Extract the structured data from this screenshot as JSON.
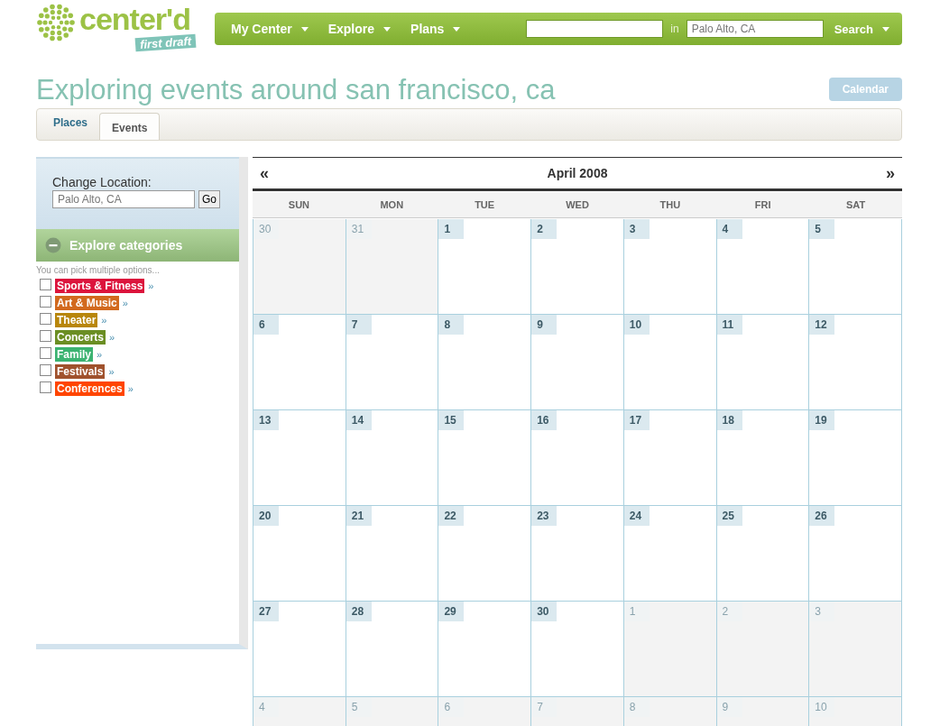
{
  "logo": {
    "name": "center'd",
    "tag": "first draft"
  },
  "nav": {
    "items": [
      {
        "label": "My Center"
      },
      {
        "label": "Explore"
      },
      {
        "label": "Plans"
      }
    ],
    "search": {
      "in_label": "in",
      "location": "Palo Alto, CA",
      "button": "Search"
    }
  },
  "title": "Exploring events around san francisco, ca",
  "calendar_button": "Calendar",
  "tabs": [
    {
      "label": "Places",
      "selected": false
    },
    {
      "label": "Events",
      "selected": true
    }
  ],
  "sidebar": {
    "location_label": "Change Location:",
    "location_value": "Palo Alto, CA",
    "go": "Go",
    "categories_title": "Explore categories",
    "hint": "You can pick multiple options...",
    "categories": [
      {
        "label": "Sports & Fitness",
        "color": "#dc143c",
        "checked": false,
        "more": "»"
      },
      {
        "label": "Art & Music",
        "color": "#d2691e",
        "checked": false,
        "more": "»"
      },
      {
        "label": "Theater",
        "color": "#b8860b",
        "checked": false,
        "more": "»"
      },
      {
        "label": "Concerts",
        "color": "#6b8e23",
        "checked": false,
        "more": "»"
      },
      {
        "label": "Family",
        "color": "#3cb371",
        "checked": false,
        "more": "»"
      },
      {
        "label": "Festivals",
        "color": "#a0522d",
        "checked": false,
        "more": "»"
      },
      {
        "label": "Conferences",
        "color": "#ff4500",
        "checked": false,
        "more": "»"
      }
    ]
  },
  "calendar": {
    "prev": "«",
    "month": "April 2008",
    "next": "»",
    "weekdays": [
      "SUN",
      "MON",
      "TUE",
      "WED",
      "THU",
      "FRI",
      "SAT"
    ],
    "weeks": [
      [
        {
          "day": "30",
          "other": true
        },
        {
          "day": "31",
          "other": true
        },
        {
          "day": "1",
          "other": false
        },
        {
          "day": "2",
          "other": false
        },
        {
          "day": "3",
          "other": false
        },
        {
          "day": "4",
          "other": false
        },
        {
          "day": "5",
          "other": false
        }
      ],
      [
        {
          "day": "6",
          "other": false
        },
        {
          "day": "7",
          "other": false
        },
        {
          "day": "8",
          "other": false
        },
        {
          "day": "9",
          "other": false
        },
        {
          "day": "10",
          "other": false
        },
        {
          "day": "11",
          "other": false
        },
        {
          "day": "12",
          "other": false
        }
      ],
      [
        {
          "day": "13",
          "other": false
        },
        {
          "day": "14",
          "other": false
        },
        {
          "day": "15",
          "other": false
        },
        {
          "day": "16",
          "other": false
        },
        {
          "day": "17",
          "other": false
        },
        {
          "day": "18",
          "other": false
        },
        {
          "day": "19",
          "other": false
        }
      ],
      [
        {
          "day": "20",
          "other": false
        },
        {
          "day": "21",
          "other": false
        },
        {
          "day": "22",
          "other": false
        },
        {
          "day": "23",
          "other": false
        },
        {
          "day": "24",
          "other": false
        },
        {
          "day": "25",
          "other": false
        },
        {
          "day": "26",
          "other": false
        }
      ],
      [
        {
          "day": "27",
          "other": false
        },
        {
          "day": "28",
          "other": false
        },
        {
          "day": "29",
          "other": false
        },
        {
          "day": "30",
          "other": false
        },
        {
          "day": "1",
          "other": true
        },
        {
          "day": "2",
          "other": true
        },
        {
          "day": "3",
          "other": true
        }
      ],
      [
        {
          "day": "4",
          "other": true
        },
        {
          "day": "5",
          "other": true
        },
        {
          "day": "6",
          "other": true
        },
        {
          "day": "7",
          "other": true
        },
        {
          "day": "8",
          "other": true
        },
        {
          "day": "9",
          "other": true
        },
        {
          "day": "10",
          "other": true
        }
      ]
    ]
  }
}
